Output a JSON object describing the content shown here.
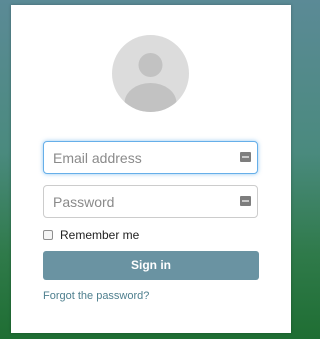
{
  "login": {
    "email_placeholder": "Email address",
    "password_placeholder": "Password",
    "remember_label": "Remember me",
    "signin_label": "Sign in",
    "forgot_label": "Forgot the password?"
  },
  "icons": {
    "avatar": "user-avatar-icon",
    "email_field_icon": "key-icon",
    "password_field_icon": "key-icon"
  },
  "colors": {
    "signin_button": "#6a93a2",
    "link": "#4e7f8e",
    "avatar_bg": "#dcdcdc",
    "avatar_fg": "#c2c2c2",
    "focus_border": "#66afe9"
  }
}
